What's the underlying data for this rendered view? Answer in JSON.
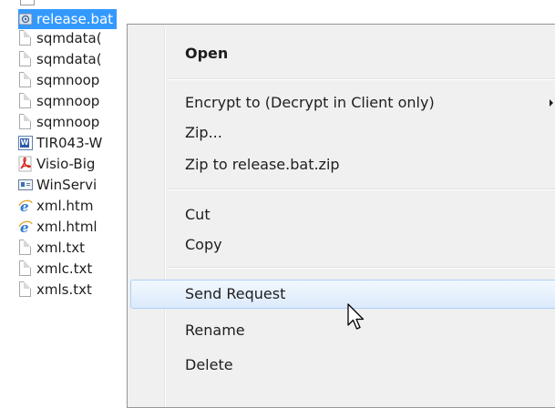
{
  "file_list": {
    "items": [
      {
        "label": "release.bat",
        "icon": "bat-file-icon",
        "selected": true
      },
      {
        "label": "sqmdata(",
        "icon": "text-file-icon"
      },
      {
        "label": "sqmdata(",
        "icon": "text-file-icon"
      },
      {
        "label": "sqmnoop",
        "icon": "text-file-icon"
      },
      {
        "label": "sqmnoop",
        "icon": "text-file-icon"
      },
      {
        "label": "sqmnoop",
        "icon": "text-file-icon"
      },
      {
        "label": "TIR043-W",
        "icon": "word-doc-icon"
      },
      {
        "label": "Visio-Big",
        "icon": "pdf-icon"
      },
      {
        "label": "WinServi",
        "icon": "window-app-icon"
      },
      {
        "label": "xml.htm",
        "icon": "ie-html-icon"
      },
      {
        "label": "xml.html",
        "icon": "ie-html-icon"
      },
      {
        "label": "xml.txt",
        "icon": "text-file-icon"
      },
      {
        "label": "xmlc.txt",
        "icon": "text-file-icon"
      },
      {
        "label": "xmls.txt",
        "icon": "text-file-icon"
      }
    ]
  },
  "context_menu": {
    "items": [
      {
        "label": "Open",
        "default": true
      },
      {
        "label": "Encrypt to (Decrypt in Client only)",
        "submenu": true
      },
      {
        "label": "Zip..."
      },
      {
        "label": "Zip to release.bat.zip"
      },
      {
        "label": "Cut"
      },
      {
        "label": "Copy"
      },
      {
        "label": "Send Request",
        "hovered": true
      },
      {
        "label": "Rename"
      },
      {
        "label": "Delete"
      }
    ]
  },
  "colors": {
    "selection": "#3399ff",
    "menu_background": "#f0f0f0",
    "hover_border": "#aecff7"
  }
}
